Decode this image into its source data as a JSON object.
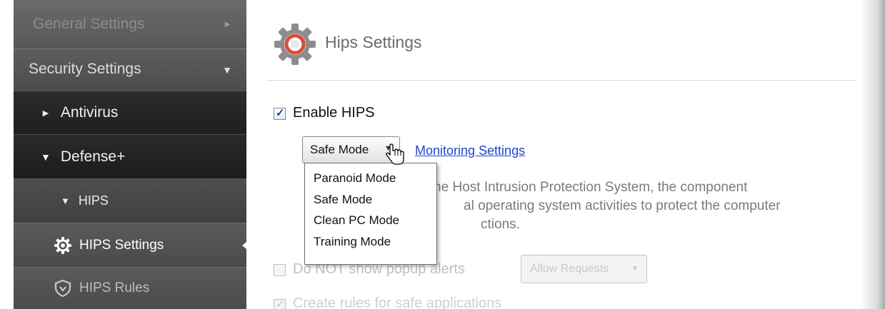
{
  "sidebar": {
    "general_settings": "General Settings",
    "security_settings": "Security Settings",
    "antivirus": "Antivirus",
    "defense_plus": "Defense+",
    "hips": "HIPS",
    "hips_settings": "HIPS Settings",
    "hips_rules": "HIPS Rules",
    "collapsed_arrow": "►",
    "expanded_arrow": "▼",
    "selected_item": "HIPS Settings"
  },
  "main": {
    "title": "Hips Settings",
    "enable_hips": {
      "label": "Enable HIPS",
      "checked": true
    },
    "mode_select": {
      "selected": "Safe Mode",
      "caret": "▼"
    },
    "monitoring_link": "Monitoring Settings",
    "mode_options": [
      "Paranoid Mode",
      "Safe Mode",
      "Clean PC Mode",
      "Training Mode"
    ],
    "description_fragments": [
      "s the Host Intrusion Protection System, the component",
      "al operating system activities to protect the computer",
      "ctions."
    ],
    "popup_alerts": {
      "label": "Do NOT show popup alerts",
      "checked": false,
      "enabled": false
    },
    "allow_requests": {
      "label": "Allow Requests",
      "caret": "▼",
      "enabled": false
    },
    "create_rules": {
      "label": "Create rules for safe applications",
      "checked": true,
      "enabled": false
    }
  },
  "colors": {
    "sidebar_dark": "#1f1f1f",
    "sidebar_mid": "#4c4c4c",
    "link": "#2244cc",
    "title_text": "#6b6b6b",
    "gear_accent": "#d94c3a"
  }
}
